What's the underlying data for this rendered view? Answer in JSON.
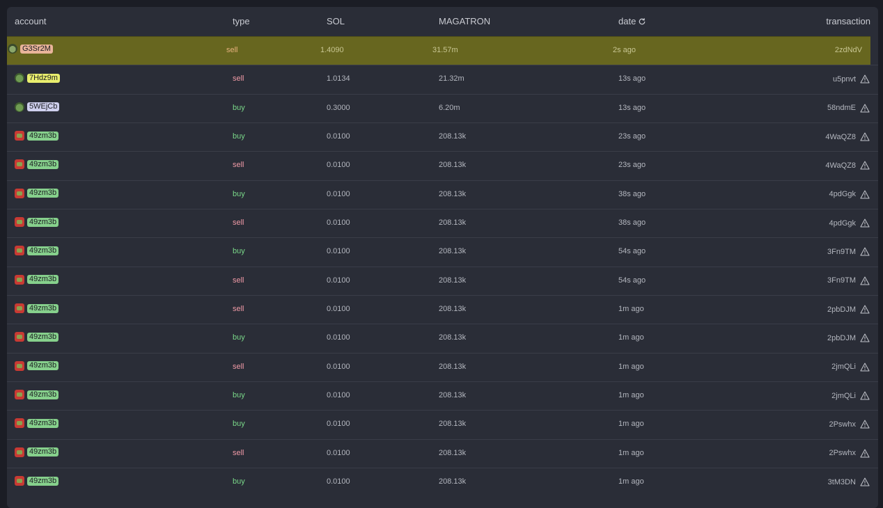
{
  "header": {
    "account": "account",
    "type": "type",
    "sol": "SOL",
    "magatron": "MAGATRON",
    "date": "date",
    "transaction": "transaction"
  },
  "rows": [
    {
      "account": "G3Sr2M",
      "badge": "peach",
      "avatar": "frog2",
      "type": "sell",
      "sol": "1.4090",
      "mag": "31.57m",
      "date": "2s ago",
      "tx": "2zdNdV",
      "warn": false,
      "highlight": true
    },
    {
      "account": "7Hdz9m",
      "badge": "yellow",
      "avatar": "frog",
      "type": "sell",
      "sol": "1.0134",
      "mag": "21.32m",
      "date": "13s ago",
      "tx": "u5pnvt",
      "warn": true
    },
    {
      "account": "5WEjCb",
      "badge": "lav",
      "avatar": "frog",
      "type": "buy",
      "sol": "0.3000",
      "mag": "6.20m",
      "date": "13s ago",
      "tx": "58ndmE",
      "warn": true
    },
    {
      "account": "49zm3b",
      "badge": "green",
      "avatar": "red",
      "type": "buy",
      "sol": "0.0100",
      "mag": "208.13k",
      "date": "23s ago",
      "tx": "4WaQZ8",
      "warn": true
    },
    {
      "account": "49zm3b",
      "badge": "green",
      "avatar": "red",
      "type": "sell",
      "sol": "0.0100",
      "mag": "208.13k",
      "date": "23s ago",
      "tx": "4WaQZ8",
      "warn": true
    },
    {
      "account": "49zm3b",
      "badge": "green",
      "avatar": "red",
      "type": "buy",
      "sol": "0.0100",
      "mag": "208.13k",
      "date": "38s ago",
      "tx": "4pdGgk",
      "warn": true
    },
    {
      "account": "49zm3b",
      "badge": "green",
      "avatar": "red",
      "type": "sell",
      "sol": "0.0100",
      "mag": "208.13k",
      "date": "38s ago",
      "tx": "4pdGgk",
      "warn": true
    },
    {
      "account": "49zm3b",
      "badge": "green",
      "avatar": "red",
      "type": "buy",
      "sol": "0.0100",
      "mag": "208.13k",
      "date": "54s ago",
      "tx": "3Fn9TM",
      "warn": true
    },
    {
      "account": "49zm3b",
      "badge": "green",
      "avatar": "red",
      "type": "sell",
      "sol": "0.0100",
      "mag": "208.13k",
      "date": "54s ago",
      "tx": "3Fn9TM",
      "warn": true
    },
    {
      "account": "49zm3b",
      "badge": "green",
      "avatar": "red",
      "type": "sell",
      "sol": "0.0100",
      "mag": "208.13k",
      "date": "1m ago",
      "tx": "2pbDJM",
      "warn": true
    },
    {
      "account": "49zm3b",
      "badge": "green",
      "avatar": "red",
      "type": "buy",
      "sol": "0.0100",
      "mag": "208.13k",
      "date": "1m ago",
      "tx": "2pbDJM",
      "warn": true
    },
    {
      "account": "49zm3b",
      "badge": "green",
      "avatar": "red",
      "type": "sell",
      "sol": "0.0100",
      "mag": "208.13k",
      "date": "1m ago",
      "tx": "2jmQLi",
      "warn": true
    },
    {
      "account": "49zm3b",
      "badge": "green",
      "avatar": "red",
      "type": "buy",
      "sol": "0.0100",
      "mag": "208.13k",
      "date": "1m ago",
      "tx": "2jmQLi",
      "warn": true
    },
    {
      "account": "49zm3b",
      "badge": "green",
      "avatar": "red",
      "type": "buy",
      "sol": "0.0100",
      "mag": "208.13k",
      "date": "1m ago",
      "tx": "2Pswhx",
      "warn": true
    },
    {
      "account": "49zm3b",
      "badge": "green",
      "avatar": "red",
      "type": "sell",
      "sol": "0.0100",
      "mag": "208.13k",
      "date": "1m ago",
      "tx": "2Pswhx",
      "warn": true
    },
    {
      "account": "49zm3b",
      "badge": "green",
      "avatar": "red",
      "type": "buy",
      "sol": "0.0100",
      "mag": "208.13k",
      "date": "1m ago",
      "tx": "3tM3DN",
      "warn": true
    }
  ],
  "icons": {
    "refresh": "refresh-icon",
    "warning": "warning-triangle-icon"
  },
  "colors": {
    "background": "#1b1d25",
    "panel": "#2a2d37",
    "highlight_row": "#67661f",
    "sell": "#f09aa6",
    "buy": "#7ad889"
  }
}
